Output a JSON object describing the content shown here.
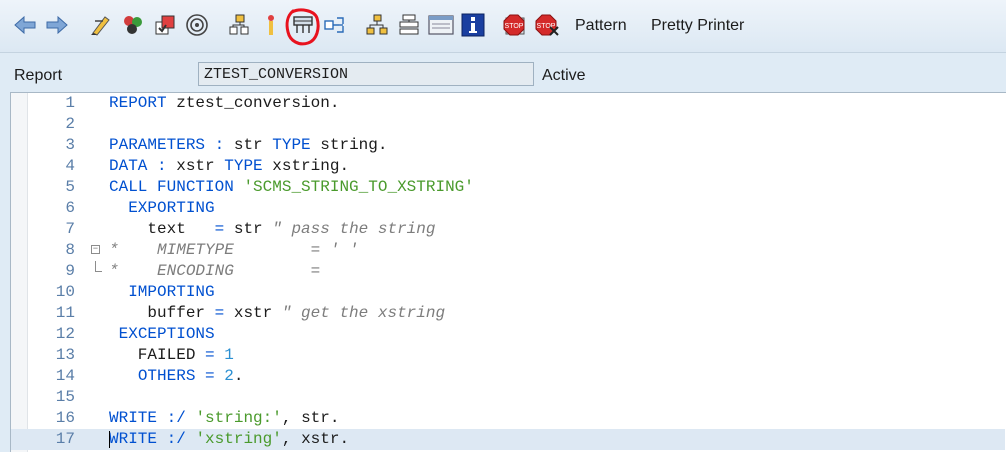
{
  "toolbar": {
    "pattern_label": "Pattern",
    "pretty_printer_label": "Pretty Printer",
    "icons": [
      "back-arrow-icon",
      "forward-arrow-icon",
      "toggle-edit-icon",
      "other-object-icon",
      "activate-icon",
      "where-used-icon",
      "check-icon",
      "test-icon",
      "display-object-list-icon",
      "navigation-window-icon",
      "hierarchy-icon",
      "inactive-objects-icon",
      "screen-icon",
      "info-icon",
      "set-breakpoint-icon",
      "delete-breakpoint-icon"
    ]
  },
  "header": {
    "label": "Report",
    "program_name": "ZTEST_CONVERSION",
    "status": "Active"
  },
  "editor": {
    "lines": [
      {
        "n": "1",
        "parts": [
          [
            "kw",
            "REPORT"
          ],
          [
            "txt",
            " ztest_conversion."
          ]
        ]
      },
      {
        "n": "2",
        "parts": []
      },
      {
        "n": "3",
        "parts": [
          [
            "kw",
            "PARAMETERS"
          ],
          [
            "txt",
            " "
          ],
          [
            "kw",
            ":"
          ],
          [
            "txt",
            " str "
          ],
          [
            "kw",
            "TYPE"
          ],
          [
            "txt",
            " string."
          ]
        ]
      },
      {
        "n": "4",
        "parts": [
          [
            "kw",
            "DATA"
          ],
          [
            "txt",
            " "
          ],
          [
            "kw",
            ":"
          ],
          [
            "txt",
            " xstr "
          ],
          [
            "kw",
            "TYPE"
          ],
          [
            "txt",
            " xstring."
          ]
        ]
      },
      {
        "n": "5",
        "parts": [
          [
            "kw",
            "CALL FUNCTION"
          ],
          [
            "txt",
            " "
          ],
          [
            "str",
            "'SCMS_STRING_TO_XSTRING'"
          ]
        ]
      },
      {
        "n": "6",
        "parts": [
          [
            "txt",
            "  "
          ],
          [
            "kw",
            "EXPORTING"
          ]
        ]
      },
      {
        "n": "7",
        "parts": [
          [
            "txt",
            "    text   "
          ],
          [
            "kw",
            "="
          ],
          [
            "txt",
            " str "
          ],
          [
            "cmt",
            "\" pass the string"
          ]
        ]
      },
      {
        "n": "8",
        "fold": "start",
        "parts": [
          [
            "cmt",
            "*    MIMETYPE        = ' '"
          ]
        ]
      },
      {
        "n": "9",
        "fold": "end",
        "parts": [
          [
            "cmt",
            "*    ENCODING        ="
          ]
        ]
      },
      {
        "n": "10",
        "parts": [
          [
            "txt",
            "  "
          ],
          [
            "kw",
            "IMPORTING"
          ]
        ]
      },
      {
        "n": "11",
        "parts": [
          [
            "txt",
            "    buffer "
          ],
          [
            "kw",
            "="
          ],
          [
            "txt",
            " xstr "
          ],
          [
            "cmt",
            "\" get the xstring"
          ]
        ]
      },
      {
        "n": "12",
        "parts": [
          [
            "txt",
            " "
          ],
          [
            "kw",
            "EXCEPTIONS"
          ]
        ]
      },
      {
        "n": "13",
        "parts": [
          [
            "txt",
            "   FAILED "
          ],
          [
            "kw",
            "="
          ],
          [
            "txt",
            " "
          ],
          [
            "num",
            "1"
          ]
        ]
      },
      {
        "n": "14",
        "parts": [
          [
            "txt",
            "   "
          ],
          [
            "kw",
            "OTHERS"
          ],
          [
            "txt",
            " "
          ],
          [
            "kw",
            "="
          ],
          [
            "txt",
            " "
          ],
          [
            "num",
            "2"
          ],
          [
            "txt",
            "."
          ]
        ]
      },
      {
        "n": "15",
        "parts": []
      },
      {
        "n": "16",
        "parts": [
          [
            "kw",
            "WRITE"
          ],
          [
            "txt",
            " "
          ],
          [
            "kw",
            ":/"
          ],
          [
            "txt",
            " "
          ],
          [
            "str",
            "'string:'"
          ],
          [
            "txt",
            ", str."
          ]
        ]
      },
      {
        "n": "17",
        "current": true,
        "parts": [
          [
            "kw",
            "WRITE"
          ],
          [
            "txt",
            " "
          ],
          [
            "kw",
            ":/"
          ],
          [
            "txt",
            " "
          ],
          [
            "str",
            "'xstring'"
          ],
          [
            "txt",
            ", xstr."
          ]
        ]
      }
    ]
  },
  "colors": {
    "keyword": "#0050d0",
    "string": "#4a9a2c",
    "number": "#2a8fd2",
    "comment": "#7d7d7d",
    "annotation": "#e8121e"
  }
}
